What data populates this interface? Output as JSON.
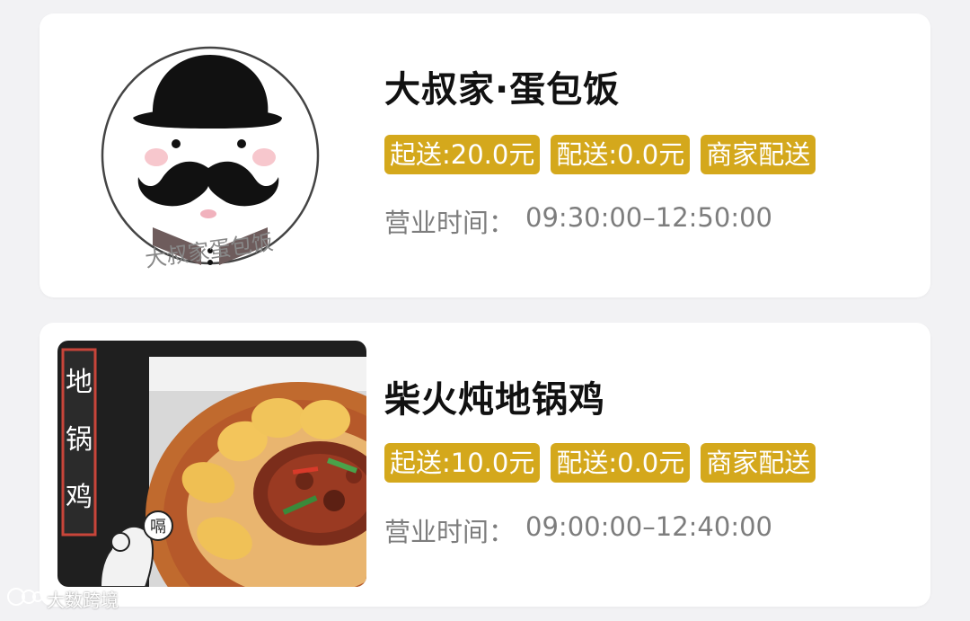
{
  "restaurants": [
    {
      "name": "大叔家·蛋包饭",
      "tags": [
        "起送:20.0元",
        "配送:0.0元",
        "商家配送"
      ],
      "hours_label": "营业时间：",
      "hours_value": "09:30:00–12:50:00",
      "logo_text": "大叔家蛋包饭",
      "image": "mustache-man-logo"
    },
    {
      "name": "柴火炖地锅鸡",
      "tags": [
        "起送:10.0元",
        "配送:0.0元",
        "商家配送"
      ],
      "hours_label": "营业时间：",
      "hours_value": "09:00:00–12:40:00",
      "logo_text": "地锅鸡",
      "image": "chicken-stew-photo"
    }
  ],
  "watermark": {
    "text": "大数跨境"
  },
  "colors": {
    "tag_background": "#d4a81c",
    "hours_text": "#7d7d7d",
    "card_background": "#ffffff",
    "page_background": "#f2f2f4"
  }
}
